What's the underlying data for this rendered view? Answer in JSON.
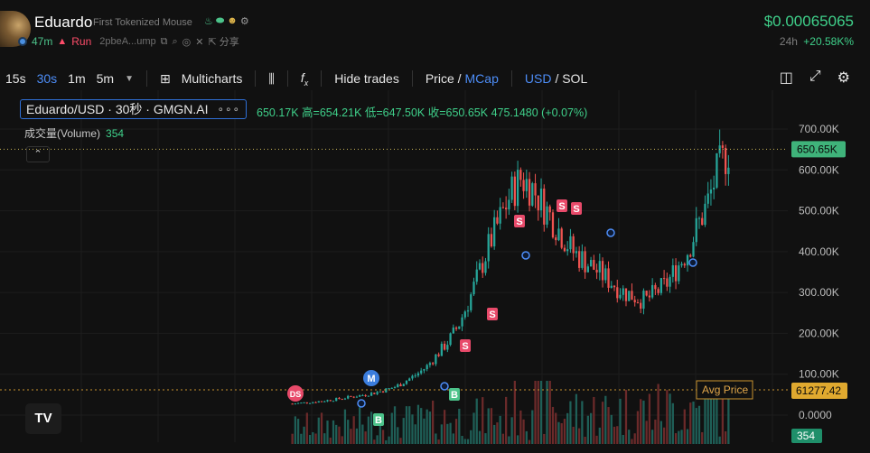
{
  "header": {
    "token_name": "Eduardo",
    "token_full_name": "First Tokenized Mouse",
    "age": "47m",
    "status": "Run",
    "address": "2pbeA...ump",
    "share": "分享",
    "price": "$0.00065065",
    "change_label": "24h",
    "change_value": "+20.58K%"
  },
  "toolbar": {
    "intervals": [
      "15s",
      "30s",
      "1m",
      "5m"
    ],
    "active_interval": "30s",
    "multicharts": "Multicharts",
    "hide_trades": "Hide trades",
    "price_label": "Price",
    "mcap_label": "MCap",
    "usd_label": "USD",
    "sol_label": "SOL",
    "slash": "/"
  },
  "legend": {
    "pair": "Eduardo/USD · 30秒 · GMGN.AI",
    "more": "∘∘∘",
    "ohlc": "650.17K 高=654.21K 低=647.50K 收=650.65K 475.1480 (+0.07%)",
    "volume_label": "成交量(Volume)",
    "volume_value": "354"
  },
  "chart_data": {
    "type": "candlestick",
    "y_axis_labels": [
      "700.00K",
      "600.00K",
      "500.00K",
      "400.00K",
      "300.00K",
      "200.00K",
      "100.00K",
      "0.0000"
    ],
    "ylim": [
      0,
      700000
    ],
    "last_price_label": "650.65K",
    "avg_price_label": "Avg Price",
    "avg_price_value": "61277.42",
    "volume_label_value": "354",
    "markers": [
      {
        "label": "DS",
        "kind": "dev-sell"
      },
      {
        "label": "M",
        "kind": "migrate"
      },
      {
        "label": "B",
        "kind": "buy"
      },
      {
        "label": "B",
        "kind": "buy"
      },
      {
        "label": "S",
        "kind": "sell"
      },
      {
        "label": "S",
        "kind": "sell"
      },
      {
        "label": "S",
        "kind": "sell"
      },
      {
        "label": "S",
        "kind": "sell"
      },
      {
        "label": "S",
        "kind": "sell"
      }
    ],
    "price_path": [
      28000,
      30000,
      32000,
      35000,
      38000,
      42000,
      46000,
      50000,
      55000,
      62000,
      70000,
      85000,
      100000,
      120000,
      150000,
      180000,
      220000,
      280000,
      350000,
      420000,
      480000,
      540000,
      580000,
      560000,
      520000,
      480000,
      440000,
      400000,
      380000,
      360000,
      340000,
      320000,
      300000,
      290000,
      280000,
      300000,
      320000,
      360000,
      400000,
      460000,
      520000,
      600000,
      650000
    ],
    "colors": {
      "up": "#26a69a",
      "down": "#ef5350",
      "up_text": "#3fd08a",
      "grid": "#1d1d1d"
    }
  }
}
